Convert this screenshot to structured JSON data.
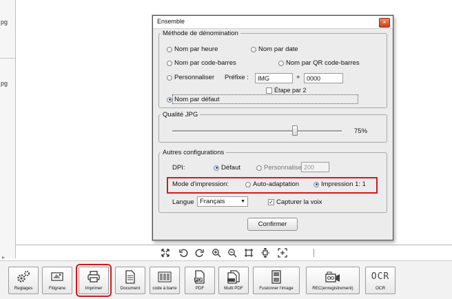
{
  "sidebar": {
    "files": [
      "pg",
      "pg"
    ]
  },
  "dialog": {
    "title": "Ensemble",
    "close_glyph": "×",
    "naming": {
      "legend": "Méthode de dénomination",
      "by_time": "Nom par heure",
      "by_date": "Nom par date",
      "by_barcode": "Nom par code-barres",
      "by_qr": "Nom par QR code-barres",
      "custom": "Personnaliser",
      "prefix_label": "Préfixe :",
      "prefix_value": "IMG",
      "plus": "+",
      "number_value": "0000",
      "step_label": "Étape par 2",
      "default": "Nom par défaut",
      "selected": "default"
    },
    "jpg": {
      "legend": "Qualité JPG",
      "value_text": "75%",
      "value": 75
    },
    "other": {
      "legend": "Autres configurations",
      "dpi_label": "DPI:",
      "dpi_default": "Défaut",
      "dpi_custom": "Personnaliser",
      "dpi_custom_value": "200",
      "print_label": "Mode d'impression:",
      "print_auto": "Auto-adaptation",
      "print_one": "Impression 1: 1",
      "print_selected": "Impression 1: 1",
      "lang_label": "Langue",
      "lang_value": "Français",
      "voice_label": "Capturer la voix",
      "voice_checked": true
    },
    "confirm": "Confirmer"
  },
  "bottom_toolbar": {
    "buttons": [
      {
        "label": "Reglages",
        "icon": "gears-icon"
      },
      {
        "label": "Filigrane",
        "icon": "watermark-icon"
      },
      {
        "label": "Imprimer",
        "icon": "printer-icon"
      },
      {
        "label": "Document",
        "icon": "document-icon"
      },
      {
        "label": "code à barre",
        "icon": "barcode-icon"
      },
      {
        "label": "PDF",
        "icon": "pdf-icon"
      },
      {
        "label": "Multi PDF",
        "icon": "multi-pdf-icon"
      },
      {
        "label": "Fusionner l'image",
        "icon": "merge-image-icon"
      },
      {
        "label": "REC(enregistrement)",
        "icon": "record-camera-icon"
      },
      {
        "label": "OCR",
        "icon_text": "OCR"
      }
    ]
  },
  "colors": {
    "highlight": "#d0191c",
    "radio_selected": "#1b4fa8"
  }
}
